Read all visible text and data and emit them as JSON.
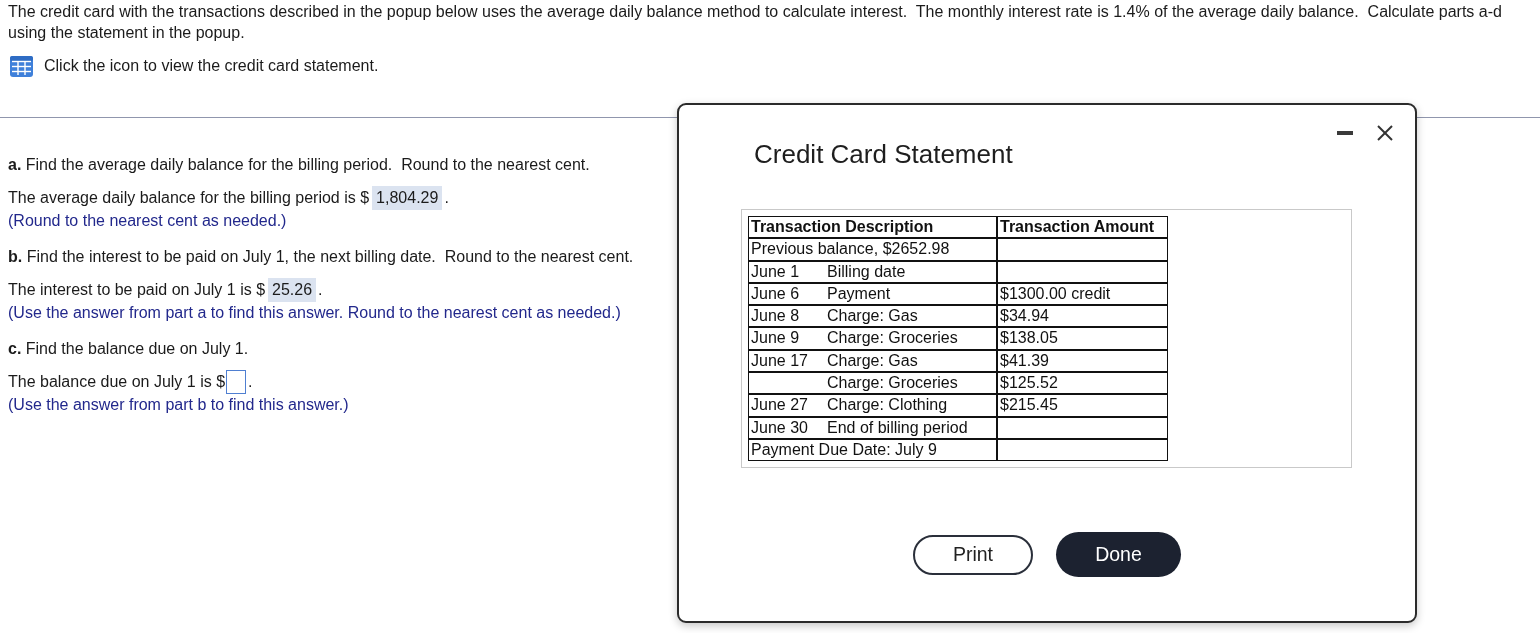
{
  "instructions": {
    "text": "The credit card with the transactions described in the popup below uses the average daily balance method to calculate interest.  The monthly interest rate is 1.4% of the average daily balance.  Calculate parts a-d using the statement in the popup.",
    "icon_label": "Click the icon to view the credit card statement."
  },
  "parts": [
    {
      "question": "**a.** Find the average daily balance for the billing period.  Round to the nearest cent.",
      "answer": {
        "prefix": "The average daily balance for the billing period is $",
        "value": "1,804.29",
        "suffix": "."
      },
      "hint": "(Round to the nearest cent as needed.)"
    },
    {
      "question": "**b.** Find the interest to be paid on July 1, the next billing date.  Round to the nearest cent.",
      "answer": {
        "prefix": "The interest to be paid on July 1 is $",
        "value": "25.26",
        "suffix": "."
      },
      "hint": "(Use the answer from part a to find this answer. Round to the nearest cent as needed.)"
    },
    {
      "question": "**c.** Find the balance due on July 1.",
      "answer": {
        "prefix": "The balance due on July 1 is $",
        "suffix": "."
      },
      "hint": "(Use the answer from part b to find this answer.)"
    }
  ],
  "popup": {
    "title": "Credit Card Statement",
    "table": {
      "columns": [
        "Transaction Description",
        "Transaction Amount"
      ],
      "rows": [
        {
          "kind": "note",
          "text": "Previous balance, $2652.98"
        },
        {
          "kind": "entry",
          "date": "June 1",
          "description": "Billing date"
        },
        {
          "kind": "entry",
          "date": "June 6",
          "description": "Payment",
          "amount": "$1300.00 credit"
        },
        {
          "kind": "entry",
          "date": "June 8",
          "description": "Charge: Gas",
          "amount": "$34.94"
        },
        {
          "kind": "entry",
          "date": "June 9",
          "description": "Charge: Groceries",
          "amount": "$138.05"
        },
        {
          "kind": "entry",
          "date": "June 17",
          "description": "Charge: Gas",
          "amount": "$41.39"
        },
        {
          "kind": "entry",
          "description": "Charge: Groceries",
          "amount": "$125.52"
        },
        {
          "kind": "entry",
          "date": "June 27",
          "description": "Charge: Clothing",
          "amount": "$215.45"
        },
        {
          "kind": "entry",
          "date": "June 30",
          "description": "End of billing period"
        },
        {
          "kind": "note",
          "text": "Payment Due Date: July 9"
        }
      ]
    },
    "buttons": [
      {
        "label": "Print",
        "kind": "secondary"
      },
      {
        "label": "Done",
        "kind": "primary"
      }
    ]
  }
}
